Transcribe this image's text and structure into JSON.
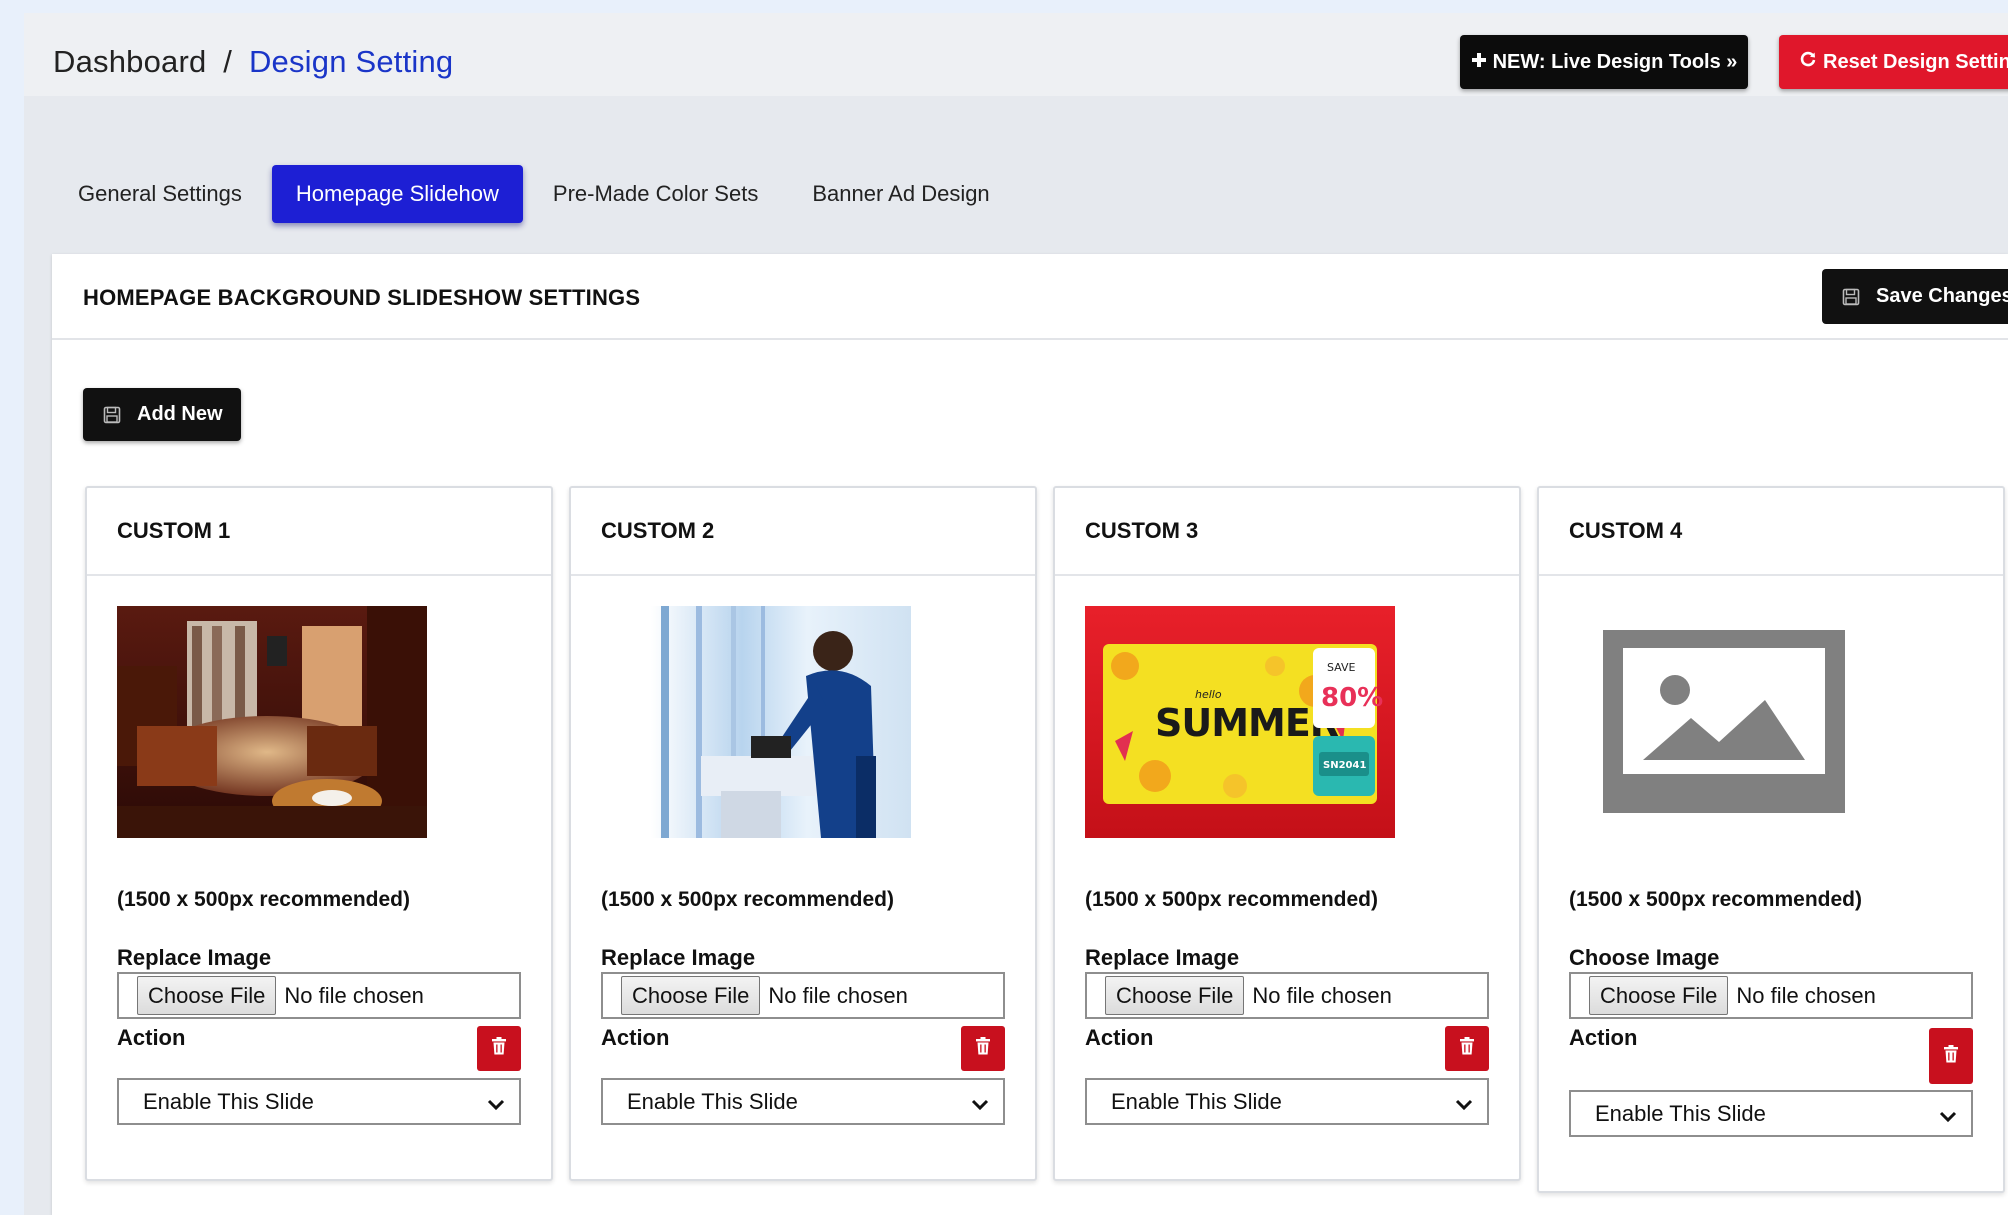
{
  "breadcrumb": {
    "home": "Dashboard",
    "separator": "/",
    "current": "Design Setting"
  },
  "header_buttons": {
    "live_tools": "NEW: Live Design Tools »",
    "reset": "Reset Design Settings"
  },
  "tabs": [
    {
      "label": "General Settings",
      "active": false
    },
    {
      "label": "Homepage Slidehow",
      "active": true
    },
    {
      "label": "Pre-Made Color Sets",
      "active": false
    },
    {
      "label": "Banner Ad Design",
      "active": false
    }
  ],
  "panel": {
    "title": "HOMEPAGE BACKGROUND SLIDESHOW SETTINGS",
    "save_label": "Save Changes",
    "add_label": "Add New"
  },
  "cards": [
    {
      "title": "CUSTOM 1",
      "image": "hotel-room-photo",
      "recommendation": "(1500 x 500px recommended)",
      "field_label": "Replace Image",
      "file_button": "Choose File",
      "file_status": "No file chosen",
      "action_label": "Action",
      "select_value": "Enable This Slide"
    },
    {
      "title": "CUSTOM 2",
      "image": "man-cleaning-window-photo",
      "recommendation": "(1500 x 500px recommended)",
      "field_label": "Replace Image",
      "file_button": "Choose File",
      "file_status": "No file chosen",
      "action_label": "Action",
      "select_value": "Enable This Slide"
    },
    {
      "title": "CUSTOM 3",
      "image": "summer-sale-banner",
      "banner_text": {
        "hello": "hello",
        "summer": "SUMMER",
        "save": "SAVE",
        "pct": "80%",
        "code": "SN2041"
      },
      "recommendation": "(1500 x 500px recommended)",
      "field_label": "Replace Image",
      "file_button": "Choose File",
      "file_status": "No file chosen",
      "action_label": "Action",
      "select_value": "Enable This Slide"
    },
    {
      "title": "CUSTOM 4",
      "image": "image-placeholder-icon",
      "recommendation": "(1500 x 500px recommended)",
      "field_label": "Choose Image",
      "file_button": "Choose File",
      "file_status": "No file chosen",
      "action_label": "Action",
      "select_value": "Enable This Slide"
    }
  ],
  "colors": {
    "accent_blue": "#1d1fd4",
    "danger_red": "#e0172b",
    "delete_red": "#c8101e",
    "dark_button": "#111111"
  }
}
